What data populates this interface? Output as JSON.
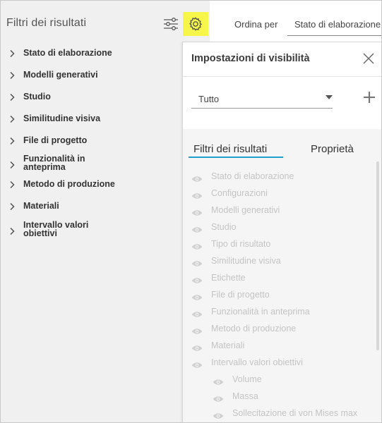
{
  "left_panel": {
    "title": "Filtri dei risultati",
    "filters": [
      {
        "label": "Stato di elaborazione",
        "multiline": false
      },
      {
        "label": "Modelli generativi",
        "multiline": false
      },
      {
        "label": "Studio",
        "multiline": false
      },
      {
        "label": "Similitudine visiva",
        "multiline": false
      },
      {
        "label": "File di progetto",
        "multiline": false
      },
      {
        "label": "Funzionalità in anteprima",
        "multiline": true
      },
      {
        "label": "Metodo di produzione",
        "multiline": false
      },
      {
        "label": "Materiali",
        "multiline": false
      },
      {
        "label": "Intervallo valori obiettivi",
        "multiline": true
      }
    ]
  },
  "sort": {
    "label": "Ordina per",
    "value": "Stato di elaborazione"
  },
  "visibility_panel": {
    "title": "Impostazioni di visibilità",
    "preset_value": "Tutto",
    "tabs": [
      "Filtri dei risultati",
      "Proprietà"
    ],
    "active_tab": 0,
    "rows": [
      {
        "label": "Stato di elaborazione",
        "indent": 0
      },
      {
        "label": "Configurazioni",
        "indent": 0
      },
      {
        "label": "Modelli generativi",
        "indent": 0
      },
      {
        "label": "Studio",
        "indent": 0
      },
      {
        "label": "Tipo di risultato",
        "indent": 0
      },
      {
        "label": "Similitudine visiva",
        "indent": 0
      },
      {
        "label": "Etichette",
        "indent": 0
      },
      {
        "label": "File di progetto",
        "indent": 0
      },
      {
        "label": "Funzionalità in anteprima",
        "indent": 0
      },
      {
        "label": "Metodo di produzione",
        "indent": 0
      },
      {
        "label": "Materiali",
        "indent": 0
      },
      {
        "label": "Intervallo valori obiettivi",
        "indent": 0
      },
      {
        "label": "Volume",
        "indent": 1
      },
      {
        "label": "Massa",
        "indent": 1
      },
      {
        "label": "Sollecitazione di von Mises max",
        "indent": 1
      }
    ]
  },
  "colors": {
    "gear_highlight": "#f5f54a",
    "tab_underline": "#1ea0cd",
    "disabled_text": "#c4c4c4"
  },
  "icons": [
    "tune-icon",
    "gear-icon",
    "chevron-right-icon",
    "close-icon",
    "caret-down-icon",
    "plus-icon",
    "eye-icon"
  ]
}
